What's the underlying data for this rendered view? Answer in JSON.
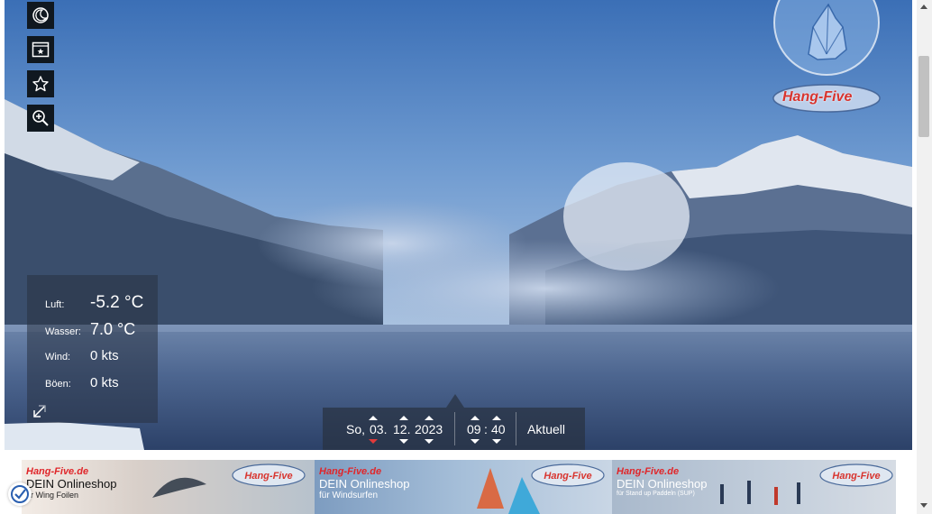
{
  "weather": {
    "air_label": "Luft:",
    "air_value": "-5.2 °C",
    "water_label": "Wasser:",
    "water_value": "7.0 °C",
    "wind_label": "Wind:",
    "wind_value": "0 kts",
    "gust_label": "Böen:",
    "gust_value": "0 kts"
  },
  "datetime": {
    "weekday": "So,",
    "day": "03.",
    "month": "12.",
    "year": "2023",
    "hour": "09",
    "separator": ":",
    "minute": "40",
    "current_button": "Aktuell"
  },
  "logo": {
    "text": "Hang-Five"
  },
  "banner": {
    "segments": [
      {
        "brand": "Hang-Five.de",
        "shop": "DEIN Onlineshop",
        "sub": "für Wing Foilen",
        "sub_visible": "r Wing Foilen"
      },
      {
        "brand": "Hang-Five.de",
        "shop": "DEIN Onlineshop",
        "sub": "für Windsurfen"
      },
      {
        "brand": "Hang-Five.de",
        "shop": "DEIN Onlineshop",
        "sub": "für Stand up Paddeln (SUP)"
      }
    ]
  },
  "icons": {
    "history": "moon-clock-icon",
    "gallery": "photo-star-icon",
    "favorite": "star-icon",
    "zoom": "zoom-in-icon",
    "expand": "expand-arrow-icon"
  },
  "colors": {
    "panel": "#283241",
    "brand_red": "#e0262a",
    "sky": "#5d8fcb"
  }
}
